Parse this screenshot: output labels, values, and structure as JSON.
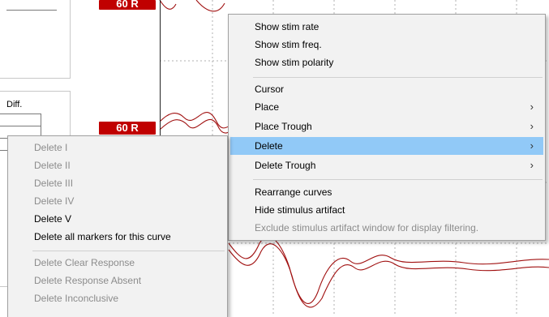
{
  "app": {
    "diff_label": "Diff.",
    "curve_label_top": "60 R",
    "curve_label_mid": "60 R",
    "colors": {
      "curve": "#a01010",
      "badge": "#c00000",
      "highlight": "#91c9f7"
    }
  },
  "context_menu": {
    "items": [
      {
        "label": "Show stim rate",
        "enabled": true
      },
      {
        "label": "Show stim freq.",
        "enabled": true
      },
      {
        "label": "Show stim polarity",
        "enabled": true
      },
      {
        "label": "Cursor",
        "enabled": true
      },
      {
        "label": "Place",
        "enabled": true,
        "submenu": true
      },
      {
        "label": "Place Trough",
        "enabled": true,
        "submenu": true
      },
      {
        "label": "Delete",
        "enabled": true,
        "submenu": true,
        "highlighted": true
      },
      {
        "label": "Delete Trough",
        "enabled": true,
        "submenu": true
      },
      {
        "label": "Rearrange curves",
        "enabled": true
      },
      {
        "label": "Hide stimulus artifact",
        "enabled": true
      },
      {
        "label": "Exclude stimulus artifact window for display filtering.",
        "enabled": false
      }
    ],
    "submenu_arrow": "›"
  },
  "delete_submenu": {
    "items": [
      {
        "label": "Delete I",
        "enabled": false
      },
      {
        "label": "Delete II",
        "enabled": false
      },
      {
        "label": "Delete III",
        "enabled": false
      },
      {
        "label": "Delete IV",
        "enabled": false
      },
      {
        "label": "Delete V",
        "enabled": true
      },
      {
        "label": "Delete all markers for this curve",
        "enabled": true
      },
      {
        "label": "Delete Clear Response",
        "enabled": false
      },
      {
        "label": "Delete Response Absent",
        "enabled": false
      },
      {
        "label": "Delete Inconclusive",
        "enabled": false
      }
    ]
  }
}
